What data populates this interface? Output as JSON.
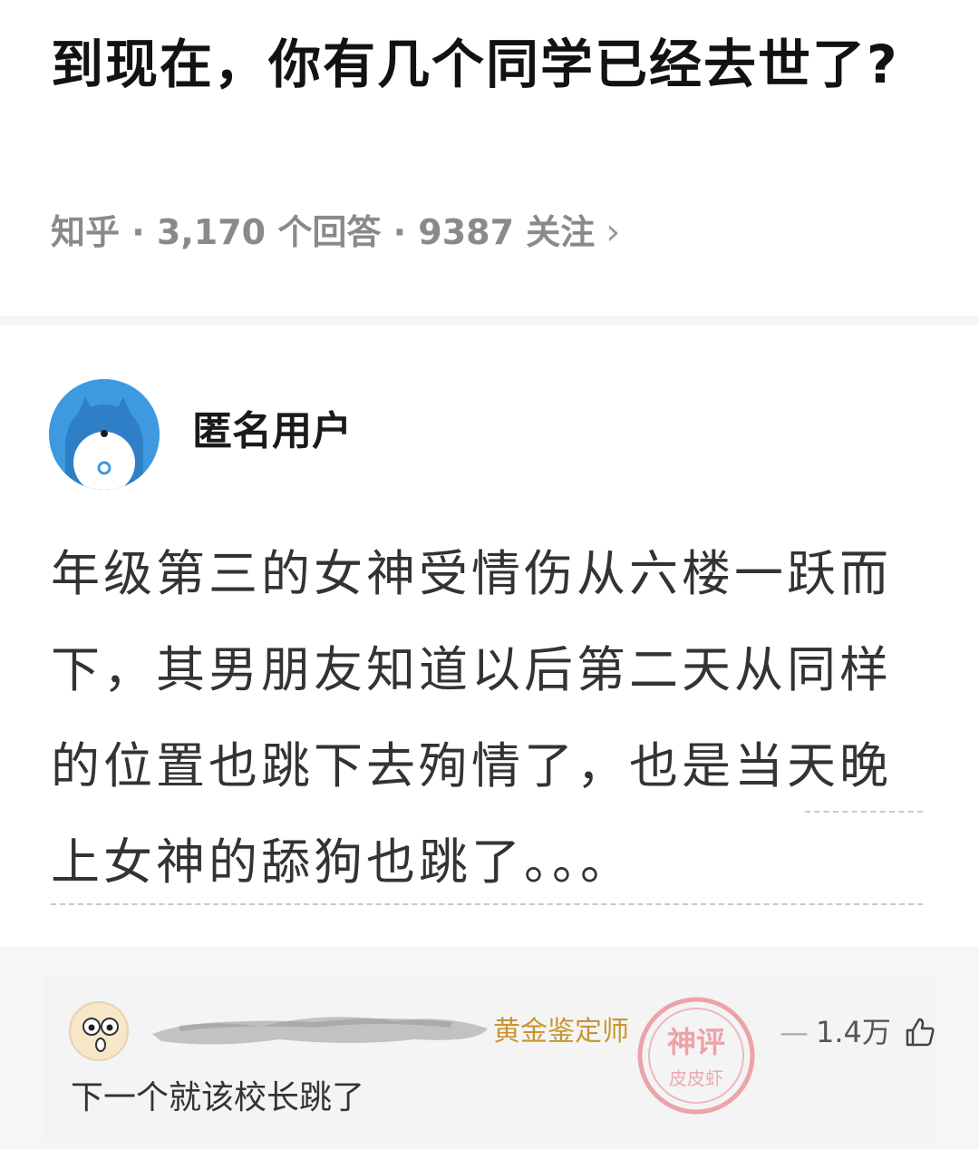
{
  "question": {
    "title": "到现在，你有几个同学已经去世了?",
    "source": "知乎",
    "answers": "3,170 个回答",
    "follows": "9387 关注",
    "chevron": "›"
  },
  "answer": {
    "author": "匿名用户",
    "text": "年级第三的女神受情伤从六楼一跃而下，其男朋友知道以后第二天从同样的位置也跳下去殉情了，也是当天晚上女神的舔狗也跳了。。。"
  },
  "comment": {
    "badge": "黄金鉴定师",
    "likes": "1.4万",
    "text": "下一个就该校长跳了",
    "watermark_top": "神评",
    "watermark_bottom": "皮皮虾"
  },
  "colors": {
    "avatar_blue": "#3d9ae0",
    "badge_gold": "#c89530",
    "watermark_red": "#e8606a"
  }
}
